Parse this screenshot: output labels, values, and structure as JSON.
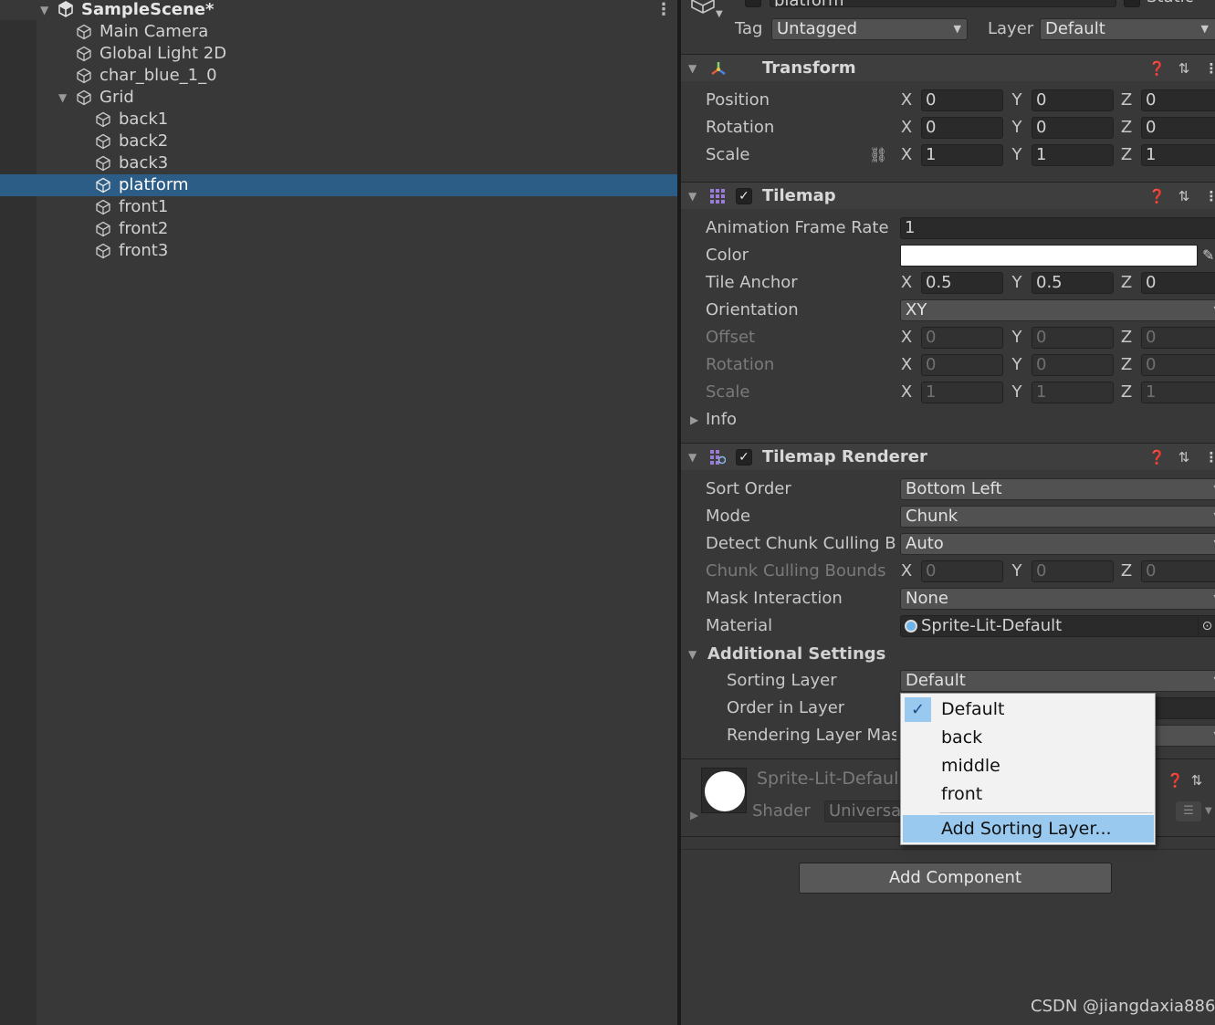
{
  "hierarchy": {
    "scene_name": "SampleScene*",
    "items": [
      {
        "label": "Main Camera"
      },
      {
        "label": "Global Light 2D"
      },
      {
        "label": "char_blue_1_0"
      },
      {
        "label": "Grid"
      },
      {
        "label": "back1"
      },
      {
        "label": "back2"
      },
      {
        "label": "back3"
      },
      {
        "label": "platform",
        "selected": true
      },
      {
        "label": "front1"
      },
      {
        "label": "front2"
      },
      {
        "label": "front3"
      }
    ]
  },
  "inspector": {
    "object_name": "platform",
    "static_label": "Static",
    "tag_label": "Tag",
    "tag_value": "Untagged",
    "layer_label": "Layer",
    "layer_value": "Default",
    "transform": {
      "title": "Transform",
      "position_label": "Position",
      "rotation_label": "Rotation",
      "scale_label": "Scale",
      "position": {
        "x": "0",
        "y": "0",
        "z": "0"
      },
      "rotation": {
        "x": "0",
        "y": "0",
        "z": "0"
      },
      "scale": {
        "x": "1",
        "y": "1",
        "z": "1"
      }
    },
    "axes": {
      "x": "X",
      "y": "Y",
      "z": "Z"
    },
    "tilemap": {
      "title": "Tilemap",
      "anim_rate_label": "Animation Frame Rate",
      "anim_rate_value": "1",
      "color_label": "Color",
      "tile_anchor_label": "Tile Anchor",
      "tile_anchor": {
        "x": "0.5",
        "y": "0.5",
        "z": "0"
      },
      "orientation_label": "Orientation",
      "orientation_value": "XY",
      "offset_label": "Offset",
      "offset": {
        "x": "0",
        "y": "0",
        "z": "0"
      },
      "rotation_label": "Rotation",
      "rotation": {
        "x": "0",
        "y": "0",
        "z": "0"
      },
      "scale_label": "Scale",
      "scale": {
        "x": "1",
        "y": "1",
        "z": "1"
      },
      "info_label": "Info"
    },
    "renderer": {
      "title": "Tilemap Renderer",
      "sort_order_label": "Sort Order",
      "sort_order_value": "Bottom Left",
      "mode_label": "Mode",
      "mode_value": "Chunk",
      "detect_label": "Detect Chunk Culling Bo",
      "detect_value": "Auto",
      "ccb_label": "Chunk Culling Bounds",
      "ccb": {
        "x": "0",
        "y": "0",
        "z": "0"
      },
      "mask_label": "Mask Interaction",
      "mask_value": "None",
      "material_label": "Material",
      "material_value": "Sprite-Lit-Default",
      "additional_label": "Additional Settings",
      "sorting_layer_label": "Sorting Layer",
      "sorting_layer_value": "Default",
      "order_label": "Order in Layer",
      "rlm_label": "Rendering Layer Mask"
    },
    "material_preview": {
      "name": "Sprite-Lit-Default",
      "shader_label": "Shader",
      "shader_value": "Universal"
    },
    "add_component": "Add Component"
  },
  "dropdown": {
    "options": [
      "Default",
      "back",
      "middle",
      "front"
    ],
    "selected": "Default",
    "add_label": "Add Sorting Layer..."
  },
  "watermark": "CSDN @jiangdaxia886"
}
